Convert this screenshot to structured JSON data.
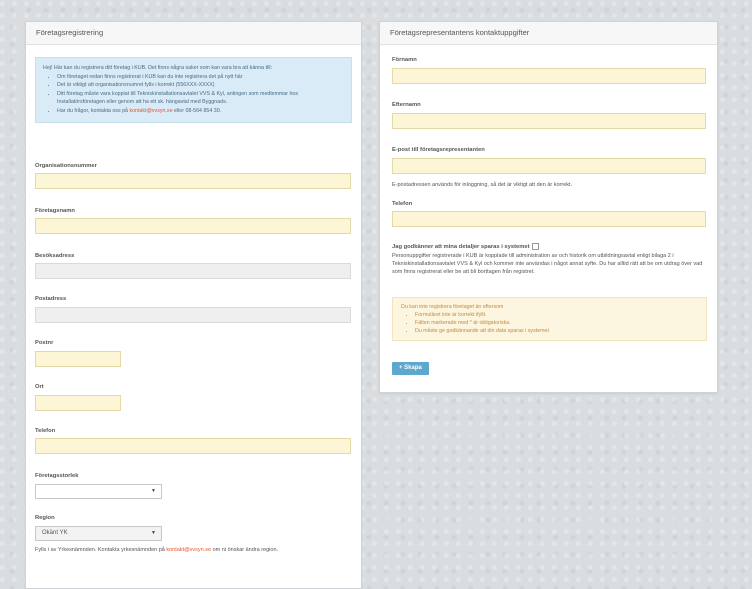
{
  "left_panel": {
    "title": "Företagsregistrering",
    "info": {
      "intro": "Hej! Här kan du registrera ditt företag i KUB. Det finns några saker som kan vara bra att känna till:",
      "bullets": [
        "Om företaget redan finns registrerat i KUB kan du inte registrera det på nytt här",
        "Det är viktigt att organisationsnumret fylls i korrekt (556XXX-XXXX)",
        "Ditt företag måste vara kopplat till Tekniskinstallationsavtalet VVS & Kyl, antingen som medlemmar hos Installatörsföretagen eller genom att ha ett sk. hängavtal med Byggnads."
      ],
      "contact_pre": "Har du frågor, kontakta oss på",
      "contact_email": "kontakt@vvsyn.se",
      "contact_post": "eller 08-564 854 30."
    },
    "fields": {
      "org_label": "Organisationsnummer",
      "name_label": "Företagsnamn",
      "visit_label": "Besöksadress",
      "post_label": "Postadress",
      "zip_label": "Postnr",
      "city_label": "Ort",
      "phone_label": "Telefon",
      "size_label": "Företagsstorlek",
      "size_value": "",
      "region_label": "Region",
      "region_value": "Okänt YK"
    },
    "footer": {
      "pre": "Fylls i av Yrkesnämnden. Kontakta yrkesnämnden på",
      "email": "kontakt@vvsyn.se",
      "post": "om ni önskar ändra region."
    }
  },
  "right_panel": {
    "title": "Företagsrepresentantens kontaktuppgifter",
    "fields": {
      "first_label": "Förnamn",
      "last_label": "Efternamn",
      "email_label": "E-post till företagsrepresentanten",
      "email_help": "E-postadressen används för inloggning, så det är viktigt att den är korrekt.",
      "phone_label": "Telefon"
    },
    "consent_label": "Jag godkänner att mina detaljer sparas i systemet",
    "consent_text": "Personuppgifter registrerade i KUB är kopplade till administration av och historik om utbildningsavtal enligt bilaga 2 i Tekniskinstallationsavtalet VVS & Kyl och kommer inte användas i något annat syfte. Du har alltid rätt att be om utdrag över vad som finns registrerat eller be att bli borttagen från registret.",
    "warning": {
      "title": "Du kan inte registrera företaget än eftersom",
      "items": [
        "Formuläret inte är korrekt ifyllt.",
        "Fälten markerade med * är obligatoriska.",
        "Du måste ge godkännande att din data sparas i systemet"
      ]
    },
    "submit_label": "+ Skapa"
  }
}
